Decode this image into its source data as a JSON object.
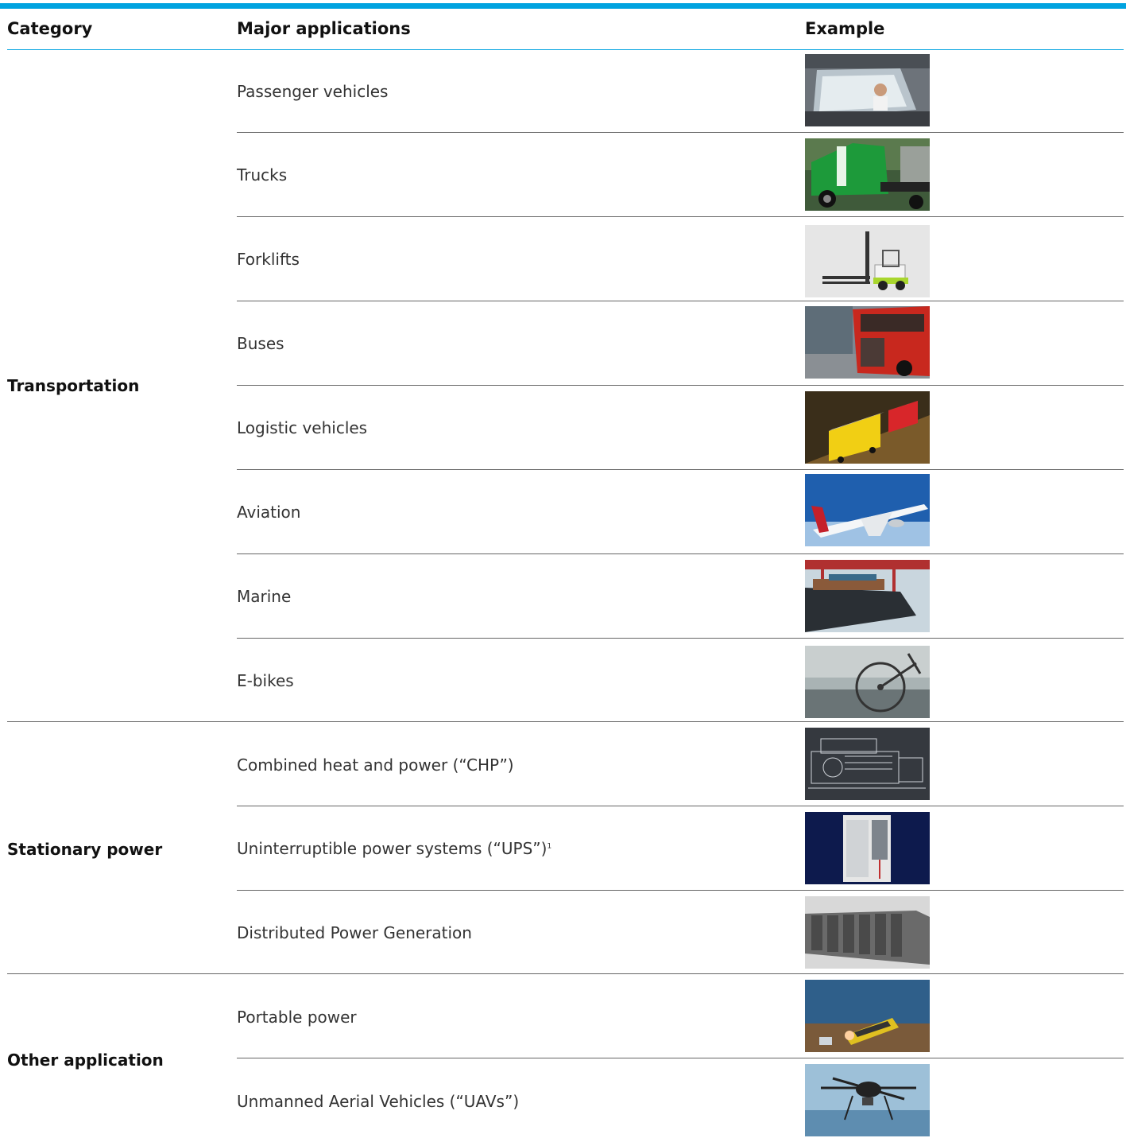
{
  "headers": {
    "category": "Category",
    "applications": "Major applications",
    "example": "Example"
  },
  "categories": [
    {
      "name": "Transportation"
    },
    {
      "name": "Stationary power"
    },
    {
      "name": "Other application"
    }
  ],
  "applications": [
    {
      "label": "Passenger vehicles"
    },
    {
      "label": "Trucks"
    },
    {
      "label": "Forklifts"
    },
    {
      "label": "Buses"
    },
    {
      "label": "Logistic vehicles"
    },
    {
      "label": "Aviation"
    },
    {
      "label": "Marine"
    },
    {
      "label": "E-bikes"
    },
    {
      "label": "Combined heat and power (“CHP”)"
    },
    {
      "label": "Uninterruptible power systems (“UPS”)",
      "footnote": "1"
    },
    {
      "label": "Distributed Power Generation"
    },
    {
      "label": "Portable power"
    },
    {
      "label": "Unmanned Aerial Vehicles (“UAVs”)"
    }
  ],
  "colors": {
    "accent": "#00a3e0",
    "divider": "#666666"
  }
}
